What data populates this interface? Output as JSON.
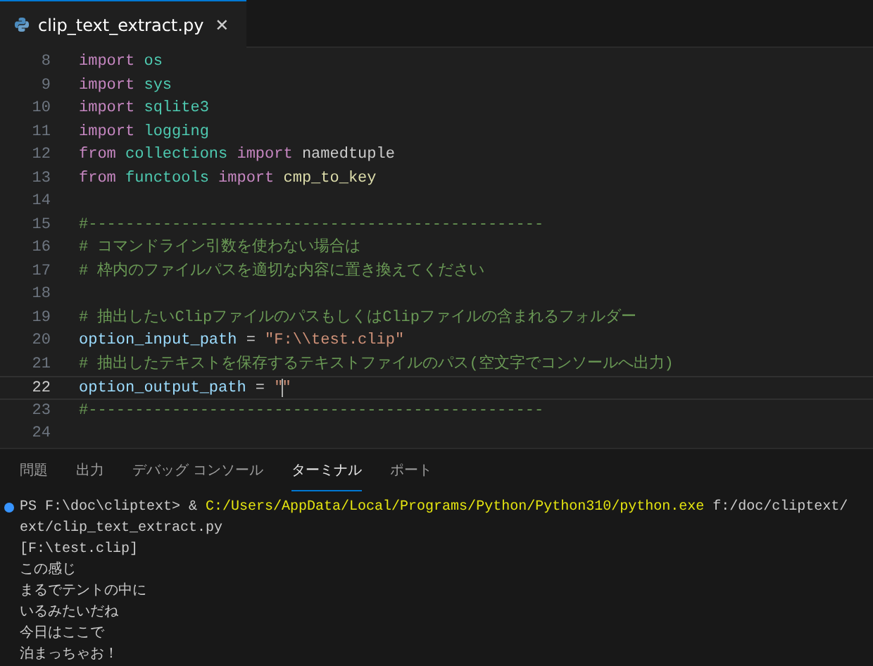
{
  "editor_tabs": [
    {
      "label": "clip_text_extract.py",
      "selected": true,
      "close": "✕"
    }
  ],
  "code_lines": [
    {
      "number": "8",
      "current": false,
      "tokens": [
        {
          "kind": "keyword",
          "text": "import "
        },
        {
          "kind": "module",
          "text": "os"
        }
      ]
    },
    {
      "number": "9",
      "current": false,
      "tokens": [
        {
          "kind": "keyword",
          "text": "import "
        },
        {
          "kind": "module",
          "text": "sys"
        }
      ]
    },
    {
      "number": "10",
      "current": false,
      "tokens": [
        {
          "kind": "keyword",
          "text": "import "
        },
        {
          "kind": "module",
          "text": "sqlite3"
        }
      ]
    },
    {
      "number": "11",
      "current": false,
      "tokens": [
        {
          "kind": "keyword",
          "text": "import "
        },
        {
          "kind": "module",
          "text": "logging"
        }
      ]
    },
    {
      "number": "12",
      "current": false,
      "tokens": [
        {
          "kind": "keyword",
          "text": "from "
        },
        {
          "kind": "module",
          "text": "collections "
        },
        {
          "kind": "keyword",
          "text": "import "
        },
        {
          "kind": "plain",
          "text": "namedtuple"
        }
      ]
    },
    {
      "number": "13",
      "current": false,
      "tokens": [
        {
          "kind": "keyword",
          "text": "from "
        },
        {
          "kind": "module",
          "text": "functools "
        },
        {
          "kind": "keyword",
          "text": "import "
        },
        {
          "kind": "func",
          "text": "cmp_to_key"
        }
      ]
    },
    {
      "number": "14",
      "current": false
    },
    {
      "number": "15",
      "current": false,
      "tokens": [
        {
          "kind": "comment",
          "text": "#-------------------------------------------------"
        }
      ]
    },
    {
      "number": "16",
      "current": false,
      "tokens": [
        {
          "kind": "comment",
          "text": "# コマンドライン引数を使わない場合は"
        }
      ]
    },
    {
      "number": "17",
      "current": false,
      "tokens": [
        {
          "kind": "comment",
          "text": "# 枠内のファイルパスを適切な内容に置き換えてください"
        }
      ]
    },
    {
      "number": "18",
      "current": false
    },
    {
      "number": "19",
      "current": false,
      "tokens": [
        {
          "kind": "comment",
          "text": "# 抽出したいClipファイルのパスもしくはClipファイルの含まれるフォルダー"
        }
      ]
    },
    {
      "number": "20",
      "current": false,
      "tokens": [
        {
          "kind": "var",
          "text": "option_input_path"
        },
        {
          "kind": "plain",
          "text": " = "
        },
        {
          "kind": "string",
          "text": "\"F:\\\\test.clip\""
        }
      ]
    },
    {
      "number": "21",
      "current": false,
      "tokens": [
        {
          "kind": "comment",
          "text": "# 抽出したテキストを保存するテキストファイルのパス(空文字でコンソールへ出力)"
        }
      ]
    },
    {
      "number": "22",
      "current": true,
      "tokens": [
        {
          "kind": "var",
          "text": "option_output_path"
        },
        {
          "kind": "plain",
          "text": " = "
        },
        {
          "kind": "string",
          "text": "\"\""
        }
      ]
    },
    {
      "number": "23",
      "current": false,
      "tokens": [
        {
          "kind": "comment",
          "text": "#-------------------------------------------------"
        }
      ]
    },
    {
      "number": "24",
      "current": false
    }
  ],
  "panel_tabs": [
    {
      "label": "問題",
      "selected": false
    },
    {
      "label": "出力",
      "selected": false
    },
    {
      "label": "デバッグ コンソール",
      "selected": false
    },
    {
      "label": "ターミナル",
      "selected": true
    },
    {
      "label": "ポート",
      "selected": false
    }
  ],
  "terminal_lines": [
    {
      "decorated": true,
      "segments": [
        {
          "kind": "plain",
          "text": "PS F:\\doc\\cliptext> & "
        },
        {
          "kind": "path",
          "text": "C:/Users/AppData/Local/Programs/Python/Python310/python.exe"
        },
        {
          "kind": "plain",
          "text": " f:/doc/cliptext/"
        }
      ]
    },
    {
      "decorated": false,
      "segments": [
        {
          "kind": "plain",
          "text": "ext/clip_text_extract.py"
        }
      ]
    },
    {
      "decorated": false,
      "segments": [
        {
          "kind": "plain",
          "text": "[F:\\test.clip]"
        }
      ]
    },
    {
      "decorated": false,
      "segments": [
        {
          "kind": "plain",
          "text": "この感じ"
        }
      ]
    },
    {
      "decorated": false,
      "segments": [
        {
          "kind": "plain",
          "text": "まるでテントの中に"
        }
      ]
    },
    {
      "decorated": false,
      "segments": [
        {
          "kind": "plain",
          "text": "いるみたいだね"
        }
      ]
    },
    {
      "decorated": false,
      "segments": [
        {
          "kind": "plain",
          "text": "今日はここで"
        }
      ]
    },
    {
      "decorated": false,
      "segments": [
        {
          "kind": "plain",
          "text": "泊まっちゃお！"
        }
      ]
    }
  ]
}
